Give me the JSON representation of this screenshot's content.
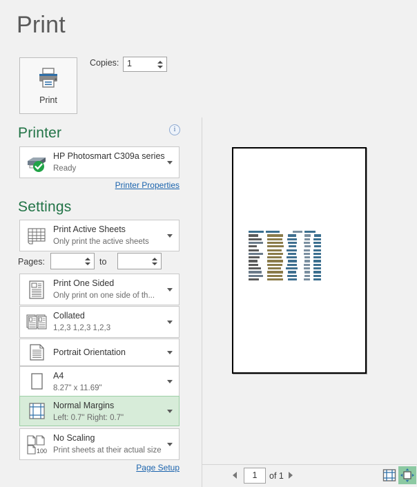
{
  "window": {
    "title": "Print"
  },
  "print_action": {
    "button_label": "Print",
    "icon": "printer-icon",
    "copies_label": "Copies:",
    "copies_value": "1"
  },
  "printer": {
    "heading": "Printer",
    "info_icon": "info-icon",
    "info_glyph": "i",
    "name": "HP Photosmart C309a series",
    "status": "Ready",
    "status_icon": "green-check-icon",
    "properties_link": "Printer Properties"
  },
  "settings": {
    "heading": "Settings",
    "pages_label": "Pages:",
    "pages_to_label": "to",
    "pages_from_value": "",
    "pages_to_value": "",
    "page_setup_link": "Page Setup",
    "items": [
      {
        "id": "what-to-print",
        "icon": "sheets-icon",
        "title": "Print Active Sheets",
        "subtitle": "Only print the active sheets",
        "selected": false
      },
      {
        "id": "print-sides",
        "icon": "one-sided-icon",
        "title": "Print One Sided",
        "subtitle": "Only print on one side of th...",
        "selected": false
      },
      {
        "id": "collation",
        "icon": "collated-icon",
        "title": "Collated",
        "subtitle": "1,2,3   1,2,3   1,2,3",
        "selected": false
      },
      {
        "id": "orientation",
        "icon": "portrait-icon",
        "title": "Portrait Orientation",
        "subtitle": "",
        "selected": false
      },
      {
        "id": "paper-size",
        "icon": "paper-icon",
        "title": "A4",
        "subtitle": "8.27\" x 11.69\"",
        "selected": false
      },
      {
        "id": "margins",
        "icon": "margins-icon",
        "title": "Normal Margins",
        "subtitle": "Left:  0.7\"   Right:  0.7\"",
        "selected": true
      },
      {
        "id": "scaling",
        "icon": "scaling-icon",
        "title": "No Scaling",
        "subtitle": "Print sheets at their actual size",
        "selected": false
      }
    ]
  },
  "preview": {
    "page_number": "1",
    "page_of": "of 1",
    "prev_icon": "previous-page-arrow-icon",
    "next_icon": "next-page-arrow-icon",
    "show_margins_icon": "show-margins-icon",
    "zoom_to_page_icon": "zoom-to-page-icon"
  },
  "colors": {
    "accent_green": "#217346",
    "link_blue": "#1a63ad",
    "selected_bg": "#d7ecd9",
    "app_bg": "#f1f1f1"
  }
}
